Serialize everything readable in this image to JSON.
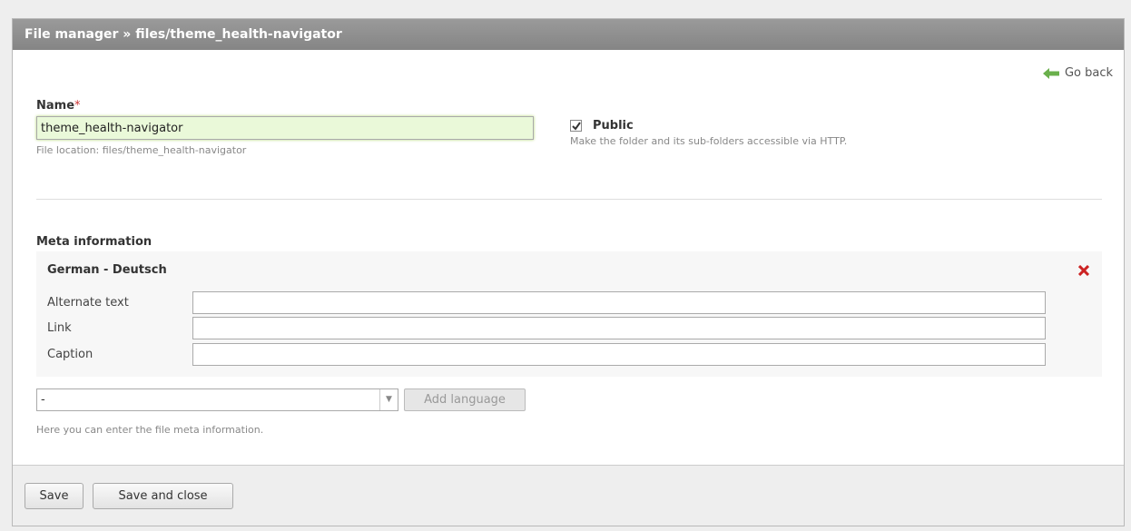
{
  "header": {
    "title": "File manager » files/theme_health-navigator"
  },
  "go_back": {
    "label": "Go back"
  },
  "name_field": {
    "label": "Name",
    "required_mark": "*",
    "value": "theme_health-navigator",
    "hint": "File location: files/theme_health-navigator"
  },
  "public": {
    "label": "Public",
    "checked": true,
    "hint": "Make the folder and its sub-folders accessible via HTTP."
  },
  "meta": {
    "title": "Meta information",
    "language": "German - Deutsch",
    "fields": [
      {
        "label": "Alternate text",
        "value": ""
      },
      {
        "label": "Link",
        "value": ""
      },
      {
        "label": "Caption",
        "value": ""
      }
    ],
    "select_value": "-",
    "add_language_label": "Add language",
    "hint": "Here you can enter the file meta information."
  },
  "footer": {
    "save_label": "Save",
    "save_close_label": "Save and close"
  },
  "colors": {
    "header_bg": "#8e8e8e",
    "input_focus_bg": "#eaf9d9",
    "remove_icon": "#cc2222",
    "go_back_arrow": "#6ab04c"
  }
}
